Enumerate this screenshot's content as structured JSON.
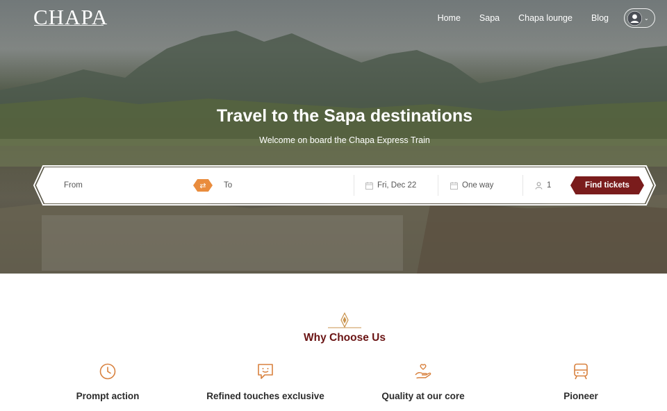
{
  "brand": {
    "logo_text": "CHAPA"
  },
  "nav": {
    "items": [
      {
        "label": "Home"
      },
      {
        "label": "Sapa"
      },
      {
        "label": "Chapa lounge"
      },
      {
        "label": "Blog"
      }
    ]
  },
  "hero": {
    "title": "Travel to the Sapa destinations",
    "subtitle": "Welcome on board the Chapa Express Train"
  },
  "search": {
    "from_placeholder": "From",
    "to_placeholder": "To",
    "date_value": "Fri, Dec 22",
    "trip_type_value": "One way",
    "passengers_value": "1",
    "find_label": "Find tickets"
  },
  "why": {
    "title": "Why Choose Us",
    "features": [
      {
        "label": "Prompt action",
        "icon": "clock-icon"
      },
      {
        "label": "Refined touches exclusive",
        "icon": "chat-smile-icon"
      },
      {
        "label": "Quality at our core",
        "icon": "hand-heart-icon"
      },
      {
        "label": "Pioneer",
        "icon": "train-icon"
      }
    ]
  },
  "colors": {
    "accent_orange": "#e98c3d",
    "brand_maroon": "#7a1c1c",
    "ornament_gold": "#c9934d"
  }
}
